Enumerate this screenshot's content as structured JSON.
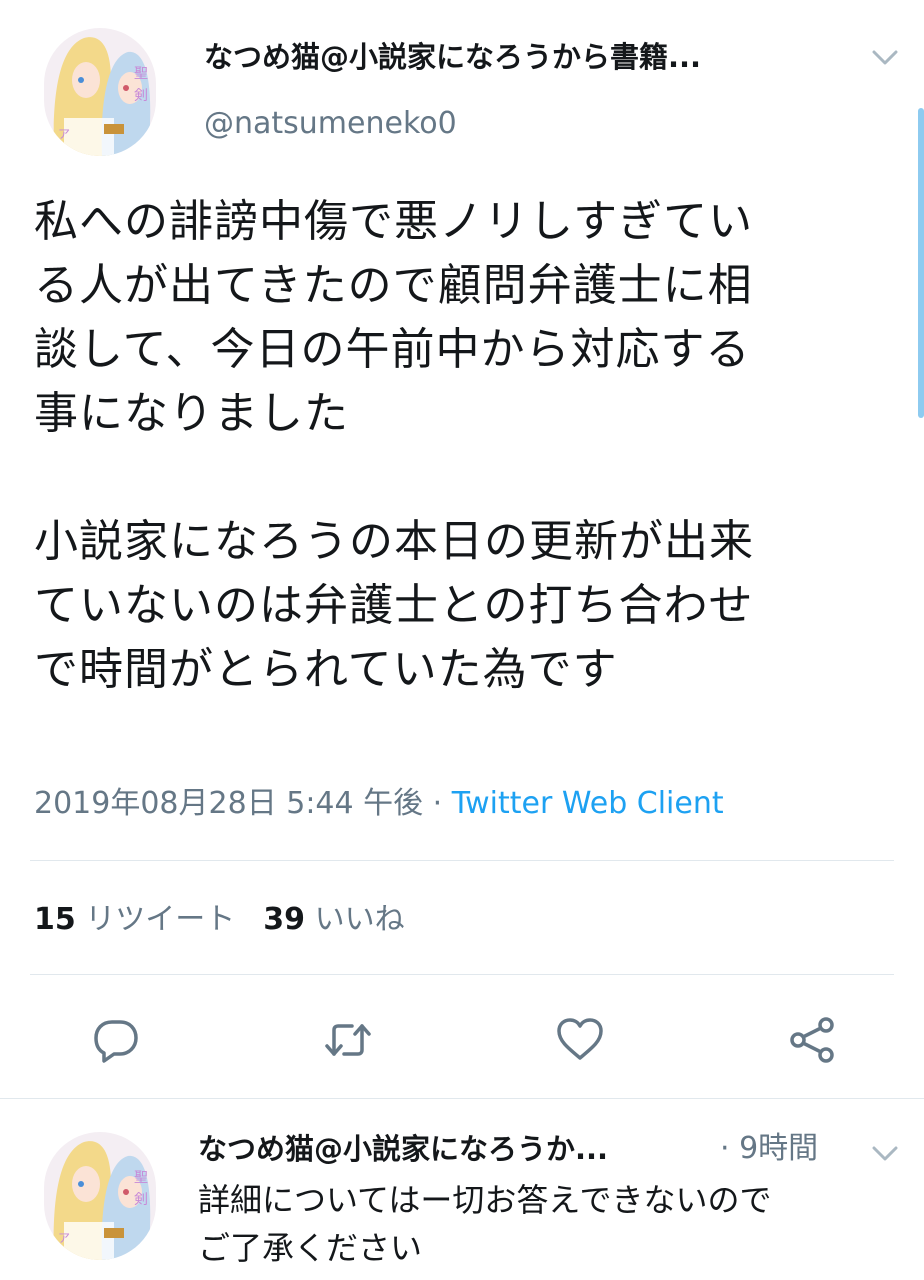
{
  "tweet": {
    "display_name": "なつめ猫@小説家になろうから書籍...",
    "handle": "@natsumeneko0",
    "text": "私への誹謗中傷で悪ノリしすぎてい\nる人が出てきたので顧問弁護士に相\n談して、今日の午前中から対応する\n事になりました\n\n小説家になろうの本日の更新が出来\nていないのは弁護士との打ち合わせ\nで時間がとられていた為です",
    "timestamp": "2019年08月28日 5:44 午後",
    "separator": " · ",
    "source": "Twitter Web Client",
    "retweet_count": "15",
    "retweet_label": "リツイート",
    "like_count": "39",
    "like_label": "いいね"
  },
  "actions": {
    "reply_icon": "reply-icon",
    "retweet_icon": "retweet-icon",
    "like_icon": "heart-icon",
    "share_icon": "share-icon"
  },
  "reply": {
    "display_name": "なつめ猫@小説家になろうか...",
    "time": "· 9時間",
    "text": "詳細についてはー切お答えできないので\nご了承ください"
  },
  "colors": {
    "secondary_text": "#657786",
    "link": "#1da1f2",
    "divider": "#e1e8ed"
  }
}
